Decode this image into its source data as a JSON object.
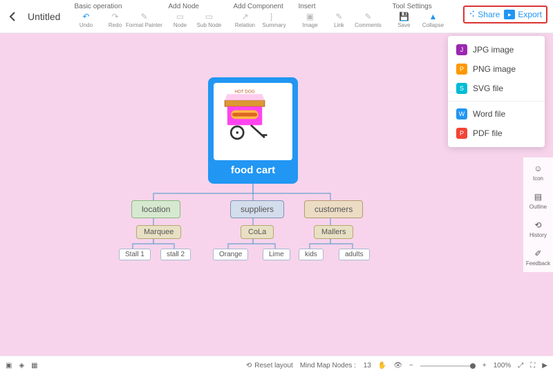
{
  "header": {
    "title": "Untitled",
    "groups": [
      {
        "label": "Basic operation",
        "tools": [
          {
            "name": "undo",
            "label": "Undo",
            "active": true
          },
          {
            "name": "redo",
            "label": "Redo",
            "active": false
          },
          {
            "name": "format-painter",
            "label": "Format Painter",
            "active": false
          }
        ]
      },
      {
        "label": "Add Node",
        "tools": [
          {
            "name": "node",
            "label": "Node",
            "active": false
          },
          {
            "name": "sub-node",
            "label": "Sub Node",
            "active": false
          }
        ]
      },
      {
        "label": "Add Component",
        "tools": [
          {
            "name": "relation",
            "label": "Relation",
            "active": false
          },
          {
            "name": "summary",
            "label": "Summary",
            "active": false
          }
        ]
      },
      {
        "label": "Insert",
        "tools": [
          {
            "name": "image",
            "label": "Image",
            "active": false
          },
          {
            "name": "link",
            "label": "Link",
            "active": false
          },
          {
            "name": "comments",
            "label": "Comments",
            "active": false
          }
        ]
      },
      {
        "label": "Tool Settings",
        "tools": [
          {
            "name": "save",
            "label": "Save",
            "active": false
          },
          {
            "name": "collapse",
            "label": "Collapse",
            "active": true
          }
        ]
      }
    ],
    "share_label": "Share",
    "export_label": "Export"
  },
  "export_menu": [
    {
      "icon": "jpg",
      "label": "JPG image"
    },
    {
      "icon": "png",
      "label": "PNG image"
    },
    {
      "icon": "svg",
      "label": "SVG file"
    },
    {
      "icon": "word",
      "label": "Word file"
    },
    {
      "icon": "pdf",
      "label": "PDF file"
    }
  ],
  "mindmap": {
    "root": {
      "label": "food cart",
      "image_hint": "HOT DOG cart illustration"
    },
    "branches": [
      {
        "label": "location",
        "children": [
          {
            "label": "Marquee",
            "children": [
              {
                "label": "Stall 1"
              },
              {
                "label": "stall 2"
              }
            ]
          }
        ]
      },
      {
        "label": "suppliers",
        "children": [
          {
            "label": "CoLa",
            "children": [
              {
                "label": "Orange"
              },
              {
                "label": "Lime"
              }
            ]
          }
        ]
      },
      {
        "label": "customers",
        "children": [
          {
            "label": "Mallers",
            "children": [
              {
                "label": "kids"
              },
              {
                "label": "adults"
              }
            ]
          }
        ]
      }
    ]
  },
  "side_rail": [
    {
      "name": "icon",
      "label": "Icon"
    },
    {
      "name": "outline",
      "label": "Outline"
    },
    {
      "name": "history",
      "label": "History"
    },
    {
      "name": "feedback",
      "label": "Feedback"
    }
  ],
  "footer": {
    "reset_label": "Reset layout",
    "nodes_label": "Mind Map Nodes :",
    "nodes_count": "13",
    "zoom": "100%"
  }
}
